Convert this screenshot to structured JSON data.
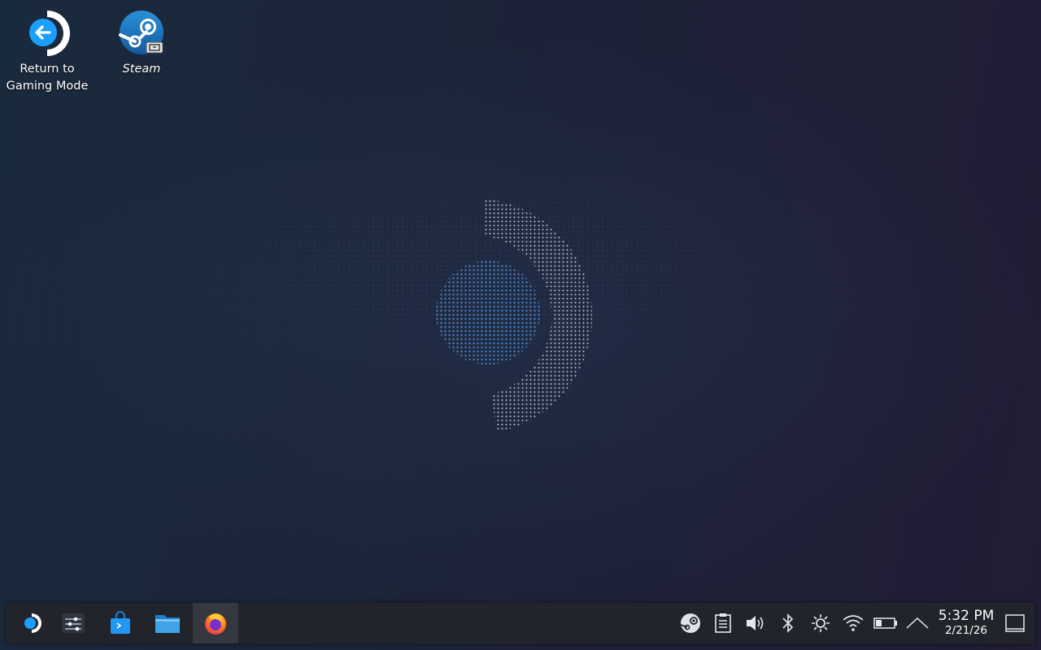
{
  "desktop": {
    "icons": [
      {
        "label": "Return to Gaming Mode",
        "icon": "return-to-gaming-mode-icon"
      },
      {
        "label": "Steam",
        "icon": "steam-icon"
      }
    ]
  },
  "taskbar": {
    "launchers": [
      {
        "name": "application-launcher",
        "icon": "steamos-logo-icon"
      },
      {
        "name": "system-settings",
        "icon": "sliders-icon"
      },
      {
        "name": "discover",
        "icon": "shopping-bag-icon"
      },
      {
        "name": "dolphin",
        "icon": "folder-icon"
      },
      {
        "name": "firefox",
        "icon": "firefox-icon",
        "active": true
      }
    ],
    "tray": [
      {
        "name": "steam",
        "icon": "steam-tray-icon"
      },
      {
        "name": "clipboard",
        "icon": "clipboard-icon"
      },
      {
        "name": "audio-volume",
        "icon": "speaker-icon"
      },
      {
        "name": "bluetooth",
        "icon": "bluetooth-icon"
      },
      {
        "name": "brightness",
        "icon": "brightness-icon"
      },
      {
        "name": "network",
        "icon": "wifi-icon"
      },
      {
        "name": "battery",
        "icon": "battery-icon"
      },
      {
        "name": "show-hidden",
        "icon": "chevron-up-icon"
      }
    ],
    "clock": {
      "time": "5:32 PM",
      "date": "2/21/26"
    },
    "show_desktop": {
      "icon": "show-desktop-icon"
    }
  },
  "colors": {
    "accent": "#1a9fff",
    "taskbar_bg": "#21252b",
    "desktop_bg_left": "#1a2a3d",
    "desktop_bg_right": "#211d35"
  }
}
